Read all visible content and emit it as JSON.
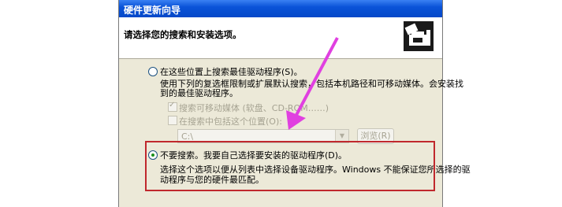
{
  "window": {
    "title": "硬件更新向导",
    "heading": "请选择您的搜索和安装选项。"
  },
  "options": {
    "search": {
      "label": "在这些位置上搜索最佳驱动程序(S)。",
      "description_line1": "使用下列的复选框限制或扩展默认搜索，包括本机路径和可移动媒体。会安装找",
      "description_line2": "到的最佳驱动程序。"
    },
    "removable_media": {
      "label": "搜索可移动媒体 (软盘、CD-ROM……)",
      "checked": true
    },
    "include_location": {
      "label": "在搜索中包括这个位置(O):",
      "checked": false,
      "path_value": "C:\\",
      "browse_label": "浏览(R)"
    },
    "dont_search": {
      "label": "不要搜索。我要自己选择要安装的驱动程序(D)。",
      "description_line1": "选择这个选项以便从列表中选择设备驱动程序。Windows 不能保证您所选择的驱",
      "description_line2": "动程序与您的硬件最匹配。",
      "selected": true
    }
  },
  "colors": {
    "annotation_arrow": "#e040e0",
    "annotation_box": "#c0282d"
  }
}
